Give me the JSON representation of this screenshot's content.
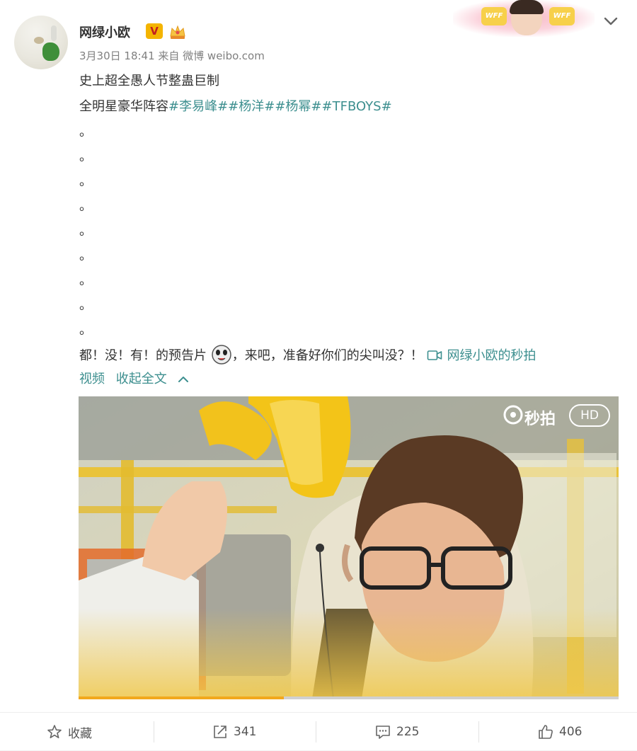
{
  "post": {
    "username": "网绿小欧",
    "vip_badge": "V",
    "meta": "3月30日 18:41 来自 微博 weibo.com",
    "line1": "史上超全愚人节整蛊巨制",
    "line2_prefix": "全明星豪华阵容",
    "topics": [
      "#李易峰#",
      "#杨洋#",
      "#杨幂#",
      "#TFBOYS#"
    ],
    "dots": [
      "。",
      "。",
      "。",
      "。",
      "。",
      "。",
      "。",
      "。",
      "。"
    ],
    "line3_a": "都！没！有！的预告片",
    "line3_b": "，来吧，准备好你们的尖叫没？！",
    "video_link_1": "网绿小欧的秒拍",
    "video_link_2": "视频",
    "collapse": "收起全文"
  },
  "decor": {
    "tag1": "WFF",
    "tag2": "WFF"
  },
  "video": {
    "brand": "秒拍",
    "quality": "HD",
    "progress": 0.38
  },
  "actions": {
    "favorite_label": "收藏",
    "repost_count": "341",
    "comment_count": "225",
    "like_count": "406"
  },
  "colors": {
    "topic": "#3d8f8f",
    "progress": "#f2a81d"
  }
}
